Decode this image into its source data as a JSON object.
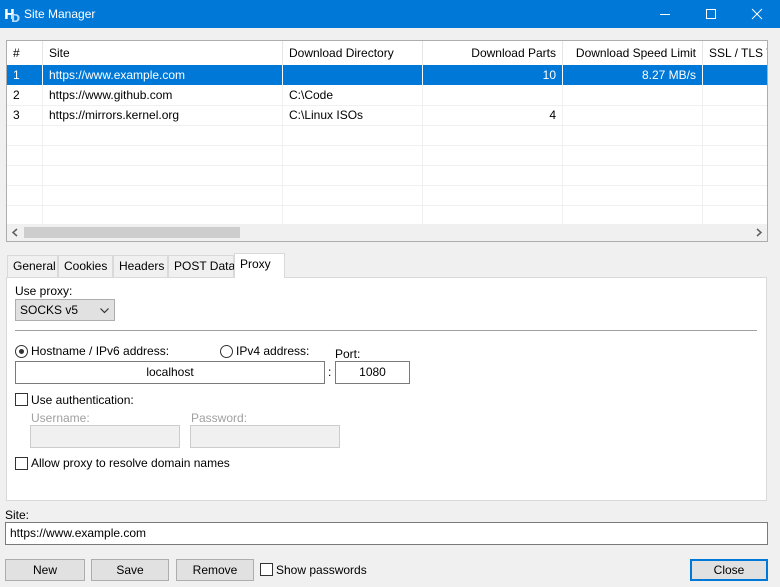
{
  "window": {
    "title": "Site Manager",
    "icon": "hp-logo-icon"
  },
  "sites_table": {
    "columns": [
      "#",
      "Site",
      "Download Directory",
      "Download Parts",
      "Download Speed Limit",
      "SSL / TLS Ve"
    ],
    "rows": [
      {
        "num": "1",
        "site": "https://www.example.com",
        "dir": "",
        "parts": "10",
        "speed": "8.27 MB/s",
        "selected": true
      },
      {
        "num": "2",
        "site": "https://www.github.com",
        "dir": "C:\\Code",
        "parts": "",
        "speed": "",
        "selected": false
      },
      {
        "num": "3",
        "site": "https://mirrors.kernel.org",
        "dir": "C:\\Linux ISOs",
        "parts": "4",
        "speed": "",
        "selected": false
      }
    ]
  },
  "tabs": [
    {
      "label": "General",
      "active": false
    },
    {
      "label": "Cookies",
      "active": false
    },
    {
      "label": "Headers",
      "active": false
    },
    {
      "label": "POST Data",
      "active": false
    },
    {
      "label": "Proxy",
      "active": true
    }
  ],
  "proxy": {
    "use_proxy_label": "Use proxy:",
    "use_proxy_value": "SOCKS v5",
    "hostname_radio_label": "Hostname / IPv6 address:",
    "hostname_selected": true,
    "ipv4_radio_label": "IPv4 address:",
    "address_value": "localhost",
    "colon": ":",
    "port_label": "Port:",
    "port_value": "1080",
    "use_auth_label": "Use authentication:",
    "use_auth_checked": false,
    "username_label": "Username:",
    "username_value": "",
    "password_label": "Password:",
    "password_value": "",
    "resolve_label": "Allow proxy to resolve domain names",
    "resolve_checked": false
  },
  "site_field": {
    "label": "Site:",
    "value": "https://www.example.com"
  },
  "buttons": {
    "new": "New",
    "save": "Save",
    "remove": "Remove",
    "show_passwords": "Show passwords",
    "close": "Close"
  },
  "colors": {
    "accent": "#0078d7",
    "window_bg": "#f0f0f0"
  }
}
